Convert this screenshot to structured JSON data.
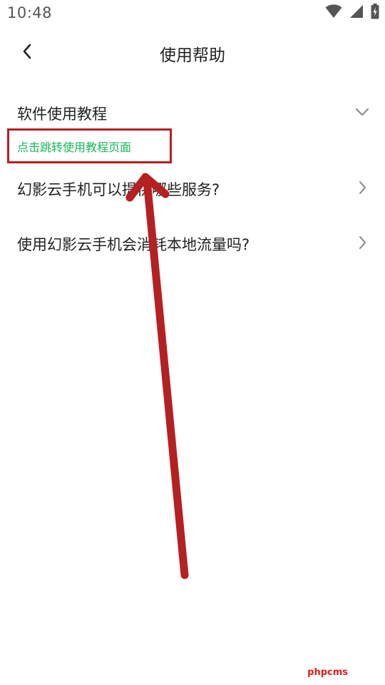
{
  "status_bar": {
    "time": "10:48",
    "icons": [
      "wifi-icon",
      "signal-icon",
      "battery-icon"
    ]
  },
  "header": {
    "title": "使用帮助",
    "back_icon": "chevron-left-icon"
  },
  "faq": {
    "items": [
      {
        "label": "软件使用教程",
        "state": "expanded",
        "chevron": "chevron-down-icon"
      },
      {
        "label": "幻影云手机可以提供哪些服务?",
        "state": "collapsed",
        "chevron": "chevron-right-icon"
      },
      {
        "label": "使用幻影云手机会消耗本地流量吗?",
        "state": "collapsed",
        "chevron": "chevron-right-icon"
      }
    ],
    "expanded_link": "点击跳转使用教程页面"
  },
  "colors": {
    "link_green": "#19b45a",
    "annotation_red": "#b52020",
    "text": "#222222"
  },
  "watermark": "phpcms"
}
